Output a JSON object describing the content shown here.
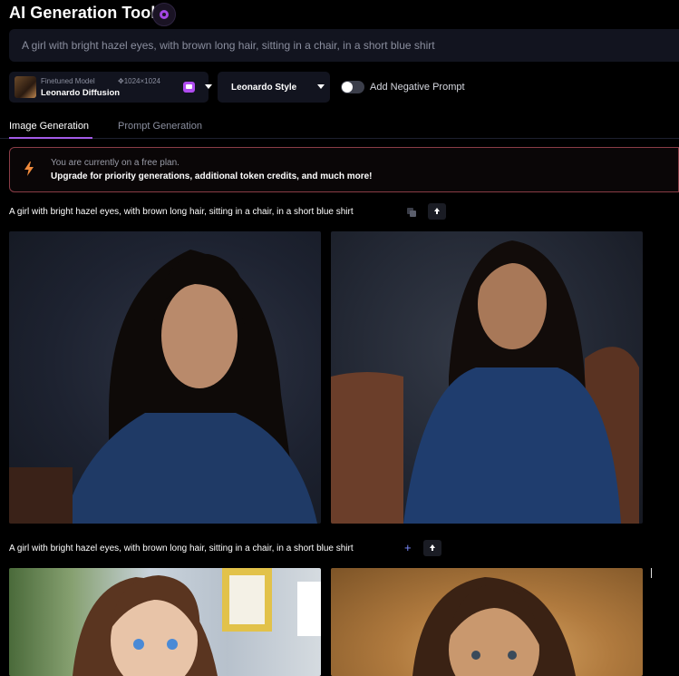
{
  "app": {
    "title": "AI Generation Tool"
  },
  "prompt": {
    "value": "A girl with bright hazel eyes, with brown long hair, sitting in a chair, in a short blue shirt"
  },
  "model": {
    "subtitle": "Finetuned Model",
    "resolution": "1024×1024",
    "name": "Leonardo Diffusion"
  },
  "style": {
    "label": "Leonardo Style"
  },
  "negative_prompt": {
    "label": "Add Negative Prompt",
    "enabled": false
  },
  "tabs": [
    {
      "label": "Image Generation",
      "active": true
    },
    {
      "label": "Prompt Generation",
      "active": false
    }
  ],
  "banner": {
    "line1": "You are currently on a free plan.",
    "line2": "Upgrade for priority generations, additional token credits, and much more!"
  },
  "generations": [
    {
      "prompt": "A girl with bright hazel eyes, with brown long hair, sitting in a chair, in a short blue shirt"
    },
    {
      "prompt": "A girl with bright hazel eyes, with brown long hair, sitting in a chair, in a short blue shirt"
    }
  ],
  "colors": {
    "accent": "#a35be8",
    "banner_border": "#8a3c46",
    "panel": "#12141f",
    "background": "#000000"
  },
  "icons": [
    "app-badge-icon",
    "chevron-down-icon",
    "bolt-icon",
    "copy-icon",
    "plus-icon",
    "arrow-up-icon"
  ]
}
